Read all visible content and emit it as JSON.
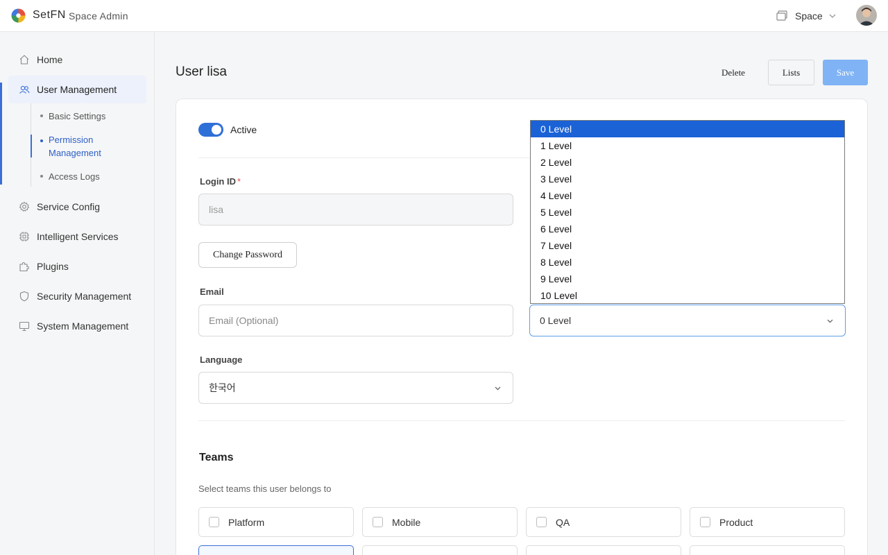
{
  "header": {
    "brand": "SetFN",
    "app_title": "Space Admin",
    "space_label": "Space"
  },
  "sidebar": {
    "items": [
      {
        "label": "Home",
        "icon": "home-icon"
      },
      {
        "label": "User Management",
        "icon": "users-icon"
      },
      {
        "label": "Service Config",
        "icon": "gear-icon"
      },
      {
        "label": "Intelligent Services",
        "icon": "chip-icon"
      },
      {
        "label": "Plugins",
        "icon": "puzzle-icon"
      },
      {
        "label": "Security Management",
        "icon": "shield-icon"
      },
      {
        "label": "System Management",
        "icon": "monitor-icon"
      }
    ],
    "sub_items": [
      {
        "label": "Basic Settings"
      },
      {
        "label": "Permission Management"
      },
      {
        "label": "Access Logs"
      }
    ]
  },
  "page": {
    "title": "User lisa",
    "delete_label": "Delete",
    "lists_label": "Lists",
    "save_label": "Save"
  },
  "form": {
    "active_label": "Active",
    "login_id_label": "Login ID",
    "required_mark": "*",
    "login_id_value": "lisa",
    "change_password_label": "Change Password",
    "email_label": "Email",
    "email_placeholder": "Email (Optional)",
    "level_value": "0 Level",
    "level_options": [
      "0 Level",
      "1 Level",
      "2 Level",
      "3 Level",
      "4 Level",
      "5 Level",
      "6 Level",
      "7 Level",
      "8 Level",
      "9 Level",
      "10 Level"
    ],
    "language_label": "Language",
    "language_value": "한국어"
  },
  "teams": {
    "title": "Teams",
    "description": "Select teams this user belongs to",
    "items": [
      "Platform",
      "Mobile",
      "QA",
      "Product"
    ]
  },
  "colors": {
    "accent": "#2f6fd8",
    "save_button": "#7fb3f5",
    "dropdown_selected": "#1a62d6",
    "required": "#e34d4d"
  }
}
